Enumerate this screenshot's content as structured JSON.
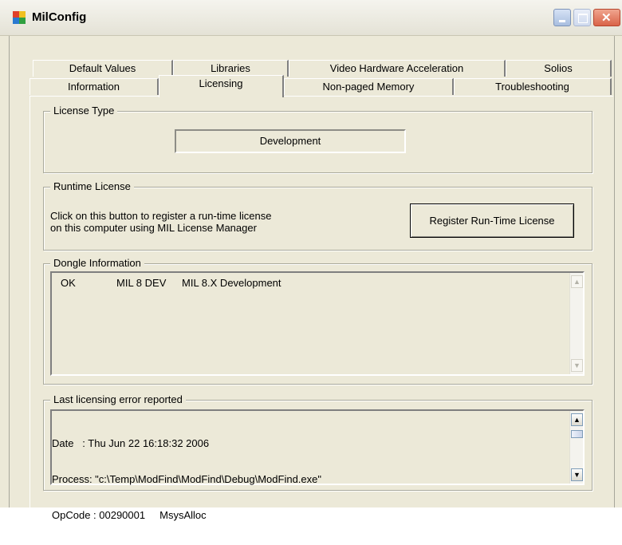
{
  "window": {
    "title": "MilConfig"
  },
  "tabs_row1": [
    "Default Values",
    "Libraries",
    "Video Hardware Acceleration",
    "Solios"
  ],
  "tabs_row2": [
    "Information",
    "Licensing",
    "Non-paged Memory",
    "Troubleshooting"
  ],
  "active_tab": "Licensing",
  "license_type": {
    "legend": "License Type",
    "value": "Development"
  },
  "runtime_license": {
    "legend": "Runtime License",
    "hint_line1": "Click on this button to register a run-time license",
    "hint_line2": "on this computer using MIL License Manager",
    "button": "Register Run-Time License"
  },
  "dongle": {
    "legend": "Dongle Information",
    "entries": [
      {
        "status": "OK",
        "code": "MIL 8 DEV",
        "description": "MIL 8.X Development"
      }
    ]
  },
  "last_error": {
    "legend": "Last licensing error reported",
    "lines": [
      "Date   : Thu Jun 22 16:18:32 2006",
      "Process: \"c:\\Temp\\ModFind\\ModFind\\Debug\\ModFind.exe\"",
      "OpCode : 00290001     MsysAlloc"
    ]
  },
  "colors": {
    "face": "#ece9d8",
    "close_button": "#d96348",
    "scroll_border": "#7f9db9"
  },
  "icons": [
    "app-icon",
    "minimize-icon",
    "maximize-icon",
    "close-icon",
    "scroll-up-icon",
    "scroll-down-icon"
  ]
}
